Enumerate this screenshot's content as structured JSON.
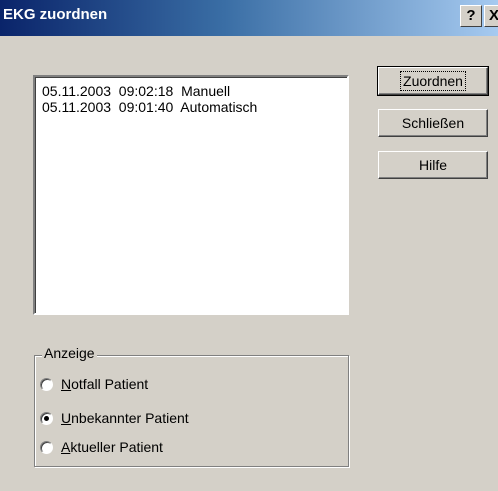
{
  "window": {
    "title": "EKG zuordnen",
    "help_glyph": "?",
    "close_glyph": "X"
  },
  "list": {
    "items": [
      "05.11.2003  09:02:18  Manuell",
      "05.11.2003  09:01:40  Automatisch"
    ]
  },
  "buttons": {
    "assign": "Zuordnen",
    "close": "Schließen",
    "help": "Hilfe"
  },
  "display_group": {
    "label": "Anzeige",
    "options": [
      {
        "accel": "N",
        "rest": "otfall Patient",
        "selected": false
      },
      {
        "accel": "U",
        "rest": "nbekannter Patient",
        "selected": true
      },
      {
        "accel": "A",
        "rest": "ktueller Patient",
        "selected": false
      }
    ]
  },
  "colors": {
    "title_gradient_start": "#0a246a",
    "title_gradient_end": "#a6caf0",
    "face": "#d4d0c8"
  }
}
